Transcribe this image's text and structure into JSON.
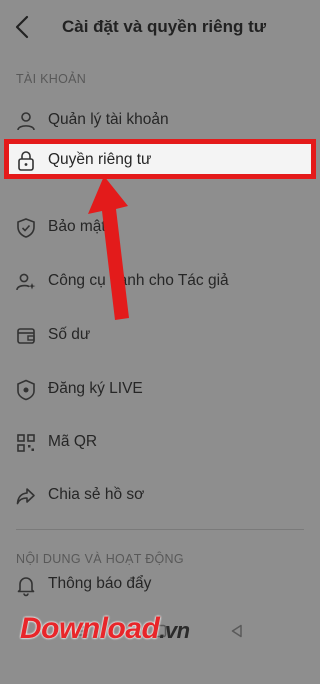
{
  "header": {
    "title": "Cài đặt và quyền riêng tư"
  },
  "sections": {
    "account": "TÀI KHOẢN",
    "content": "NỘI DUNG VÀ HOẠT ĐỘNG"
  },
  "items": [
    {
      "label": "Quản lý tài khoản",
      "icon": "user-icon"
    },
    {
      "label": "Quyền riêng tư",
      "icon": "lock-icon"
    },
    {
      "label": "Bảo mật",
      "icon": "shield-check-icon"
    },
    {
      "label": "Công cụ dành cho Tác giả",
      "icon": "creator-user-icon"
    },
    {
      "label": "Số dư",
      "icon": "wallet-icon"
    },
    {
      "label": "Đăng ký LIVE",
      "icon": "live-badge-icon"
    },
    {
      "label": "Mã QR",
      "icon": "qr-code-icon"
    },
    {
      "label": "Chia sẻ hồ sơ",
      "icon": "share-icon"
    },
    {
      "label": "Thông báo đẩy",
      "icon": "bell-icon"
    }
  ],
  "watermark": {
    "main": "Download",
    "ext": ".vn"
  },
  "colors": {
    "background": "#8e8e8e",
    "highlight": "#e41a1a",
    "highlight_fill": "#f4f4f4"
  }
}
